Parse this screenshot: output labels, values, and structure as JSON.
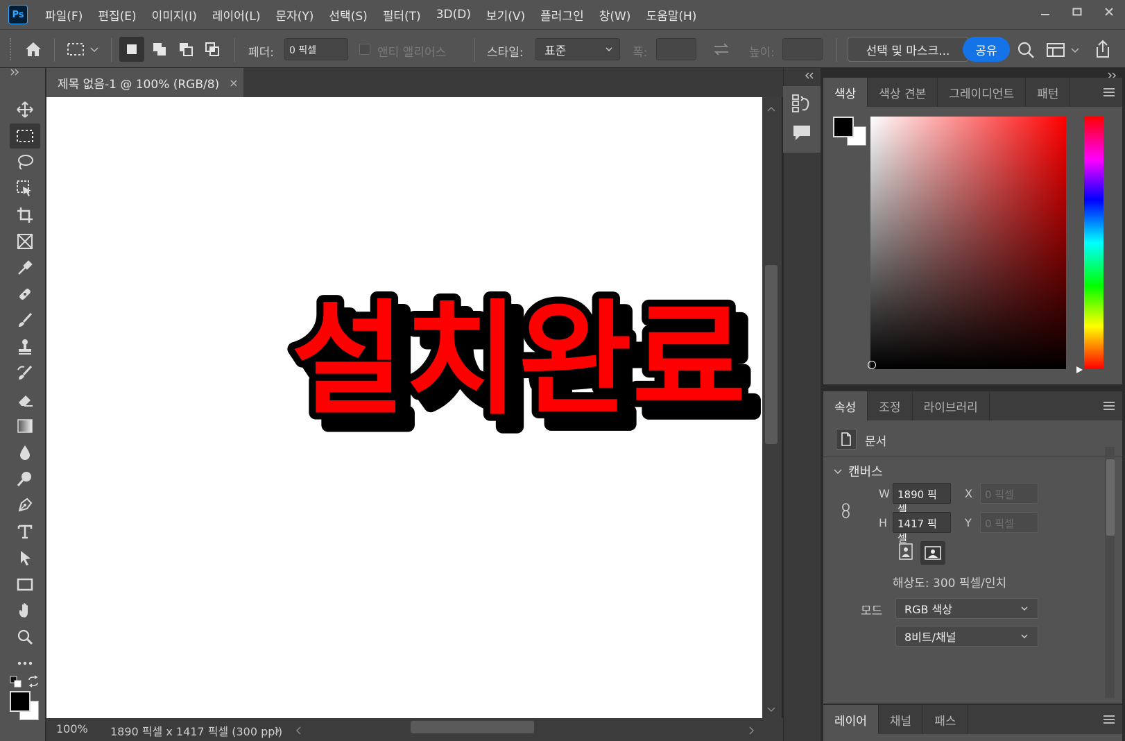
{
  "app": {
    "logo": "Ps",
    "menu": [
      "파일(F)",
      "편집(E)",
      "이미지(I)",
      "레이어(L)",
      "문자(Y)",
      "선택(S)",
      "필터(T)",
      "3D(D)",
      "보기(V)",
      "플러그인",
      "창(W)",
      "도움말(H)"
    ]
  },
  "options_bar": {
    "feather_label": "페더:",
    "feather_value": "0 픽셀",
    "antialias_label": "앤티 앨리어스",
    "style_label": "스타일:",
    "style_value": "표준",
    "width_label": "폭:",
    "height_label": "높이:",
    "select_mask_label": "선택 및 마스크...",
    "share_label": "공유"
  },
  "document": {
    "tab_title": "제목 없음-1 @ 100% (RGB/8)",
    "close_glyph": "×",
    "canvas_text": "설치완료",
    "text_color": "#ff0000",
    "stroke_color": "#000000",
    "zoom": "100%",
    "status_info": "1890 픽셀 x 1417 픽셀 (300 ppi)"
  },
  "color_panel": {
    "tabs": [
      "색상",
      "색상 견본",
      "그레이디언트",
      "패턴"
    ],
    "active_tab": "색상",
    "hue_color": "#ff0000"
  },
  "properties_panel": {
    "tabs": [
      "속성",
      "조정",
      "라이브러리"
    ],
    "active_tab": "속성",
    "doc_label": "문서",
    "section_label": "캔버스",
    "w_label": "W",
    "w_value": "1890 픽셀",
    "h_label": "H",
    "h_value": "1417 픽셀",
    "x_label": "X",
    "x_placeholder": "0 픽셀",
    "y_label": "Y",
    "y_placeholder": "0 픽셀",
    "resolution": "해상도: 300 픽셀/인치",
    "mode_label": "모드",
    "mode_value": "RGB 색상",
    "depth_value": "8비트/채널"
  },
  "layers_panel": {
    "tabs": [
      "레이어",
      "채널",
      "패스"
    ],
    "active_tab": "레이어"
  }
}
